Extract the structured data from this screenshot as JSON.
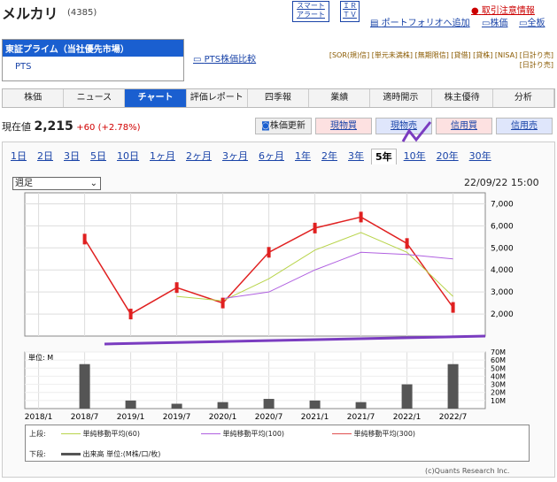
{
  "header": {
    "name": "メルカリ",
    "code": "(4385)",
    "btn_smart": [
      "スマート",
      "アラート"
    ],
    "btn_ir": [
      "ＩＲ",
      "ＴＶ"
    ],
    "link_notice": "取引注意情報",
    "link_portfolio": "ポートフォリオへ追加",
    "link_stock": "株価",
    "link_all": "全板"
  },
  "market": {
    "selected": "東証プライム（当社優先市場）",
    "pts": "PTS",
    "compare": "PTS株価比較"
  },
  "tags": {
    "line1": "[SOR(規)信] [単元未満株] [無期限信] [貸借] [貸株] [NISA] [日計り売]",
    "line2": "[日計り売]"
  },
  "nav": [
    "株価",
    "ニュース",
    "チャート",
    "評価レポート",
    "四季報",
    "業績",
    "適時開示",
    "株主優待",
    "分析"
  ],
  "price": {
    "label": "現在値",
    "value": "2,215",
    "change": "+60 (+2.78%)"
  },
  "actions": {
    "update": "株価更新",
    "genbutsu_buy": "現物買",
    "genbutsu_sell": "現物売",
    "shinyo_buy": "信用買",
    "shinyo_sell": "信用売"
  },
  "periods": [
    "1日",
    "2日",
    "3日",
    "5日",
    "10日",
    "1ヶ月",
    "2ヶ月",
    "3ヶ月",
    "6ヶ月",
    "1年",
    "2年",
    "3年",
    "5年",
    "10年",
    "20年",
    "30年"
  ],
  "chart_controls": {
    "interval": "週足",
    "timestamp": "22/09/22 15:00"
  },
  "legend": {
    "upper": "上段:",
    "ma60": "単純移動平均(60)",
    "ma100": "単純移動平均(100)",
    "ma300": "単純移動平均(300)",
    "lower": "下段:",
    "volume": "出来高 単位:(M株/口/枚)"
  },
  "source": "(c)Quants Research Inc.",
  "colors": {
    "accent": "#1a5fd0",
    "candle": "#e02020",
    "ma60": "#b8d44a",
    "ma100": "#b060e0",
    "ma300": "#e05050",
    "trend": "#7a3cc0"
  },
  "chart_data": [
    {
      "type": "line",
      "ylim": [
        1000,
        7500
      ],
      "yticks": [
        "2,000",
        "3,000",
        "4,000",
        "5,000",
        "6,000",
        "7,000"
      ],
      "x": [
        "2018/1",
        "2018/7",
        "2019/1",
        "2019/7",
        "2020/1",
        "2020/7",
        "2021/1",
        "2021/7",
        "2022/1",
        "2022/7"
      ],
      "series": [
        {
          "name": "株価",
          "values": [
            null,
            5400,
            2000,
            3200,
            2500,
            4800,
            5900,
            6400,
            5200,
            2300
          ]
        },
        {
          "name": "単純移動平均(60)",
          "values": [
            null,
            null,
            null,
            2800,
            2600,
            3600,
            4900,
            5700,
            4800,
            2800
          ]
        },
        {
          "name": "単純移動平均(100)",
          "values": [
            null,
            null,
            null,
            null,
            2700,
            3000,
            4000,
            4800,
            4700,
            4500
          ]
        }
      ]
    },
    {
      "type": "bar",
      "unit": "単位: M",
      "ylim": [
        0,
        70
      ],
      "yticks": [
        "10M",
        "20M",
        "30M",
        "40M",
        "50M",
        "60M",
        "70M"
      ],
      "x": [
        "2018/1",
        "2018/7",
        "2019/1",
        "2019/7",
        "2020/1",
        "2020/7",
        "2021/1",
        "2021/7",
        "2022/1",
        "2022/7"
      ],
      "values": [
        0,
        55,
        10,
        6,
        8,
        12,
        10,
        8,
        30,
        55
      ]
    }
  ]
}
